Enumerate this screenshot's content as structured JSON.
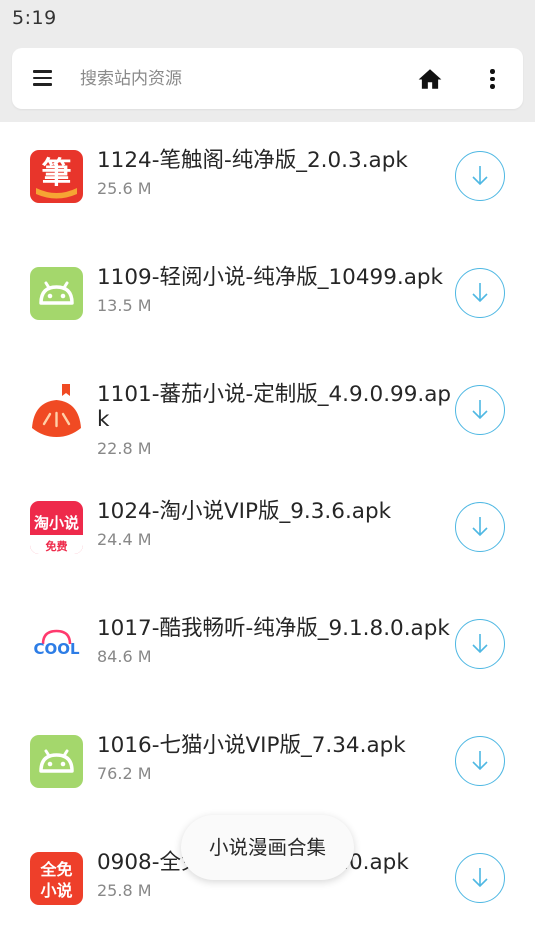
{
  "status": {
    "time": "5:19"
  },
  "search": {
    "placeholder": "搜索站内资源",
    "value": ""
  },
  "icons": {
    "menu": "hamburger-menu-icon",
    "home": "home-icon",
    "more": "more-vertical-icon",
    "download": "download-arrow-icon"
  },
  "files": [
    {
      "name": "1124-笔触阁-纯净版_2.0.3.apk",
      "size": "25.6 M",
      "icon": "bichuge-app-icon",
      "icon_color": "#e8352b"
    },
    {
      "name": "1109-轻阅小说-纯净版_10499.apk",
      "size": "13.5 M",
      "icon": "android-default-icon",
      "icon_color": "#a4d76c"
    },
    {
      "name": "1101-蕃茄小说-定制版_4.9.0.99.apk",
      "size": "22.8 M",
      "icon": "fanqie-app-icon",
      "icon_color": "#f04a23"
    },
    {
      "name": "1024-淘小说VIP版_9.3.6.apk",
      "size": "24.4 M",
      "icon": "taoxiaoshuo-app-icon",
      "icon_color": "#ee2a4b"
    },
    {
      "name": "1017-酷我畅听-纯净版_9.1.8.0.apk",
      "size": "84.6 M",
      "icon": "kuwo-app-icon",
      "icon_color": "#ff3a6e"
    },
    {
      "name": "1016-七猫小说VIP版_7.34.apk",
      "size": "76.2 M",
      "icon": "android-default-icon",
      "icon_color": "#a4d76c"
    },
    {
      "name": "0908-全免小说-纯净版_7.0.apk",
      "size": "25.8 M",
      "icon": "quanmian-app-icon",
      "icon_color": "#ee3f2a"
    }
  ],
  "app_icon_text": {
    "bichuge": "筆",
    "taoxiaoshuo_top": "淘小说",
    "taoxiaoshuo_bottom": "免费",
    "quanmian_top": "全免",
    "quanmian_bottom": "小说",
    "kuwo": "COOL"
  },
  "colors": {
    "accent": "#4fb8e3",
    "status_bar_bg": "#ececec"
  },
  "floating_button": {
    "label": "小说漫画合集"
  }
}
